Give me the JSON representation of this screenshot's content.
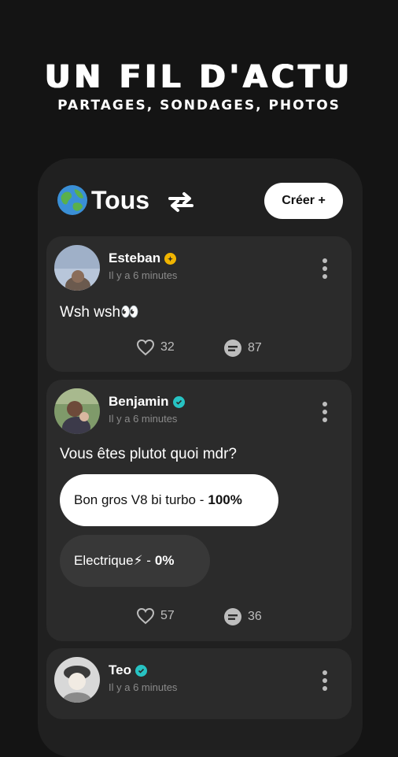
{
  "hero": {
    "title": "UN FIL D'ACTU",
    "subtitle": "PARTAGES, SONDAGES, PHOTOS"
  },
  "feed": {
    "title": "Tous",
    "create_label": "Créer +",
    "globe_icon": "globe-emoji-icon",
    "swap_icon": "swap-arrows-icon"
  },
  "posts": [
    {
      "author": "Esteban",
      "badge_color": "#f0b400",
      "time": "Il y a 6 minutes",
      "text": "Wsh wsh👀",
      "likes": "32",
      "comments": "87"
    },
    {
      "author": "Benjamin",
      "badge_color": "#27c3c3",
      "time": "Il y a 6 minutes",
      "text": "Vous êtes plutot quoi mdr?",
      "poll": [
        {
          "label": "Bon gros V8 bi turbo -",
          "percent": "100%",
          "selected": true
        },
        {
          "label": "Electrique⚡ -",
          "percent": "0%",
          "selected": false
        }
      ],
      "likes": "57",
      "comments": "36"
    },
    {
      "author": "Teo",
      "badge_color": "#27c3c3",
      "time": "Il y a 6 minutes"
    }
  ]
}
